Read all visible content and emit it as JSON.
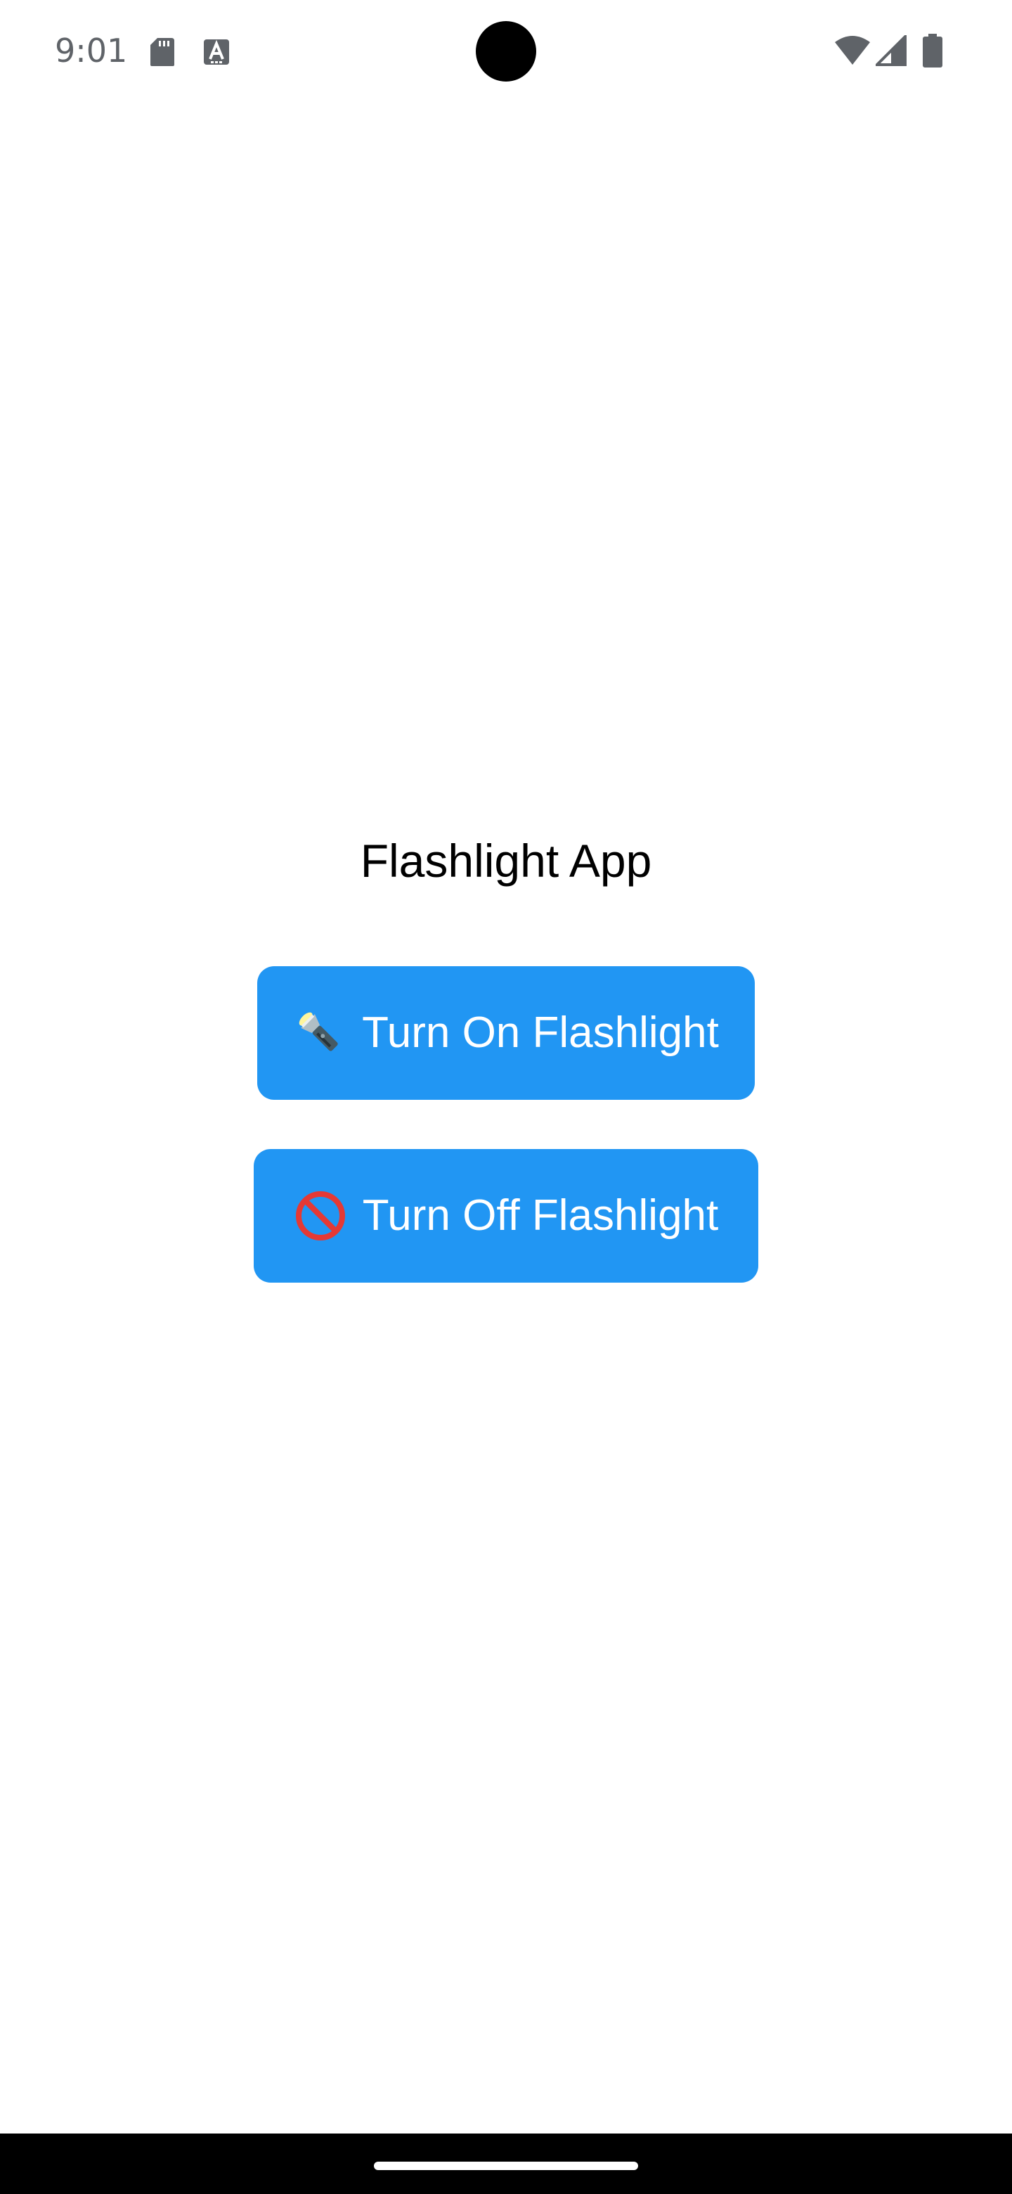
{
  "status_bar": {
    "time": "9:01",
    "left_icons": [
      "sd-card-icon",
      "a-text-icon"
    ],
    "right_icons": [
      "wifi-icon",
      "cell-signal-icon",
      "battery-icon"
    ]
  },
  "main": {
    "title": "Flashlight App",
    "buttons": [
      {
        "label": "Turn On Flashlight",
        "icon": "flashlight-icon"
      },
      {
        "label": "Turn Off Flashlight",
        "icon": "prohibited-icon"
      }
    ]
  },
  "colors": {
    "button_bg": "#2196f3",
    "button_text": "#ffffff",
    "title_text": "#000000",
    "status_icons": "#5f6368",
    "nav_bar": "#000000"
  }
}
